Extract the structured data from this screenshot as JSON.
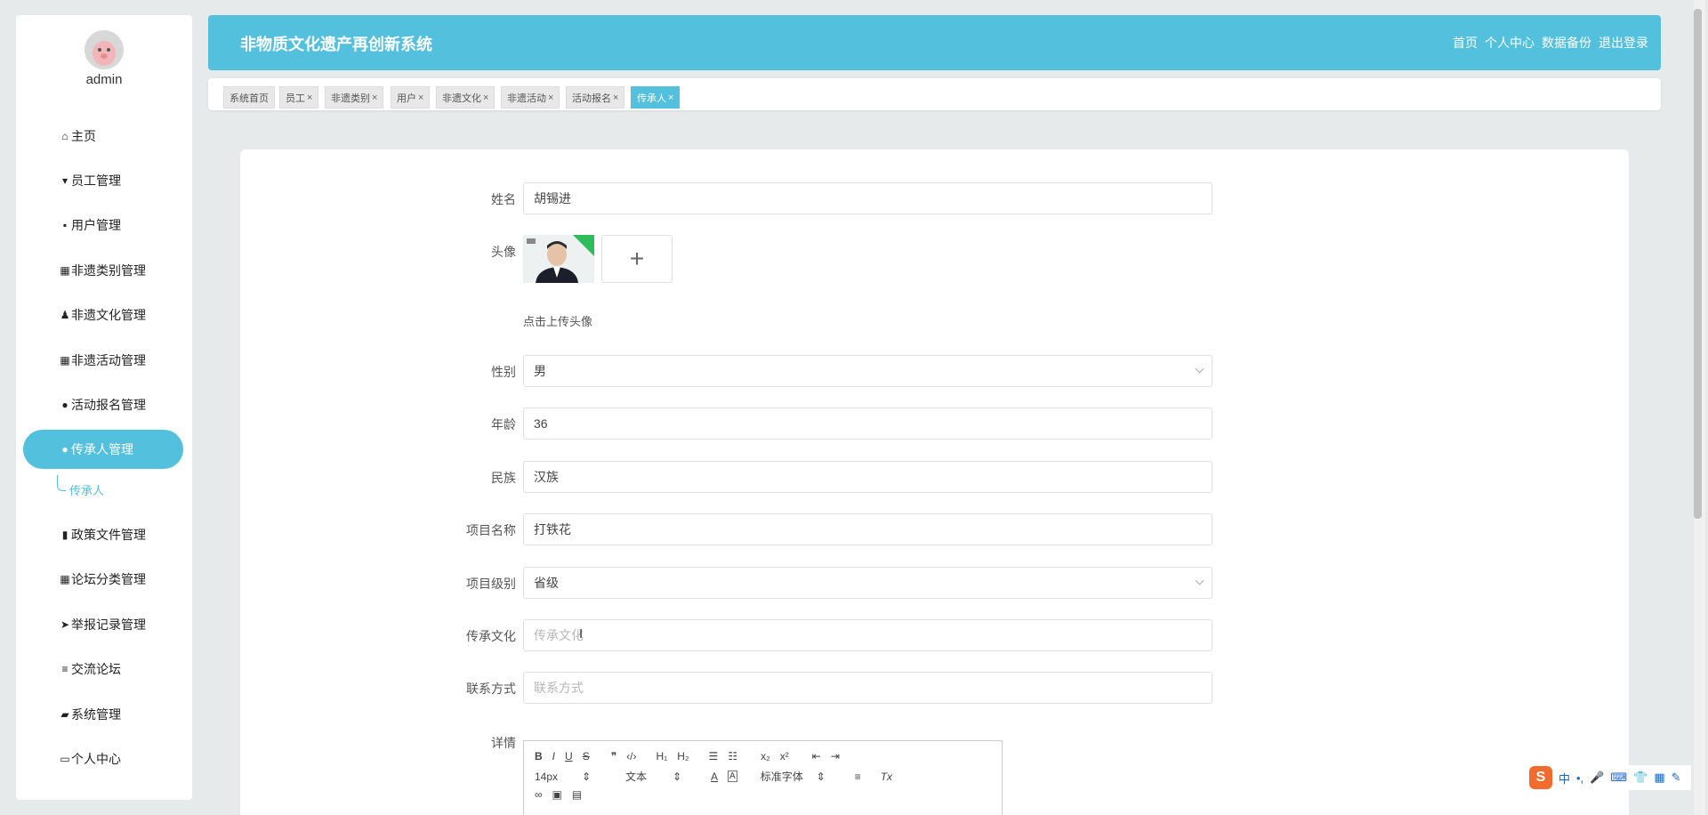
{
  "sidebar": {
    "admin_name": "admin",
    "items": [
      {
        "label": "主页",
        "icon": "home-icon"
      },
      {
        "label": "员工管理",
        "icon": "employee-icon"
      },
      {
        "label": "用户管理",
        "icon": "chat-icon"
      },
      {
        "label": "非遗类别管理",
        "icon": "grid-icon"
      },
      {
        "label": "非遗文化管理",
        "icon": "user-icon"
      },
      {
        "label": "非遗活动管理",
        "icon": "grid-icon"
      },
      {
        "label": "活动报名管理",
        "icon": "person-icon"
      },
      {
        "label": "传承人管理",
        "icon": "bulb-icon"
      },
      {
        "label": "政策文件管理",
        "icon": "bar-chart-icon"
      },
      {
        "label": "论坛分类管理",
        "icon": "grid-icon"
      },
      {
        "label": "举报记录管理",
        "icon": "send-icon"
      },
      {
        "label": "交流论坛",
        "icon": "list-icon"
      },
      {
        "label": "系统管理",
        "icon": "briefcase-icon"
      },
      {
        "label": "个人中心",
        "icon": "calendar-icon"
      }
    ],
    "sub_item": "传承人"
  },
  "header": {
    "title": "非物质文化遗产再创新系统",
    "nav": [
      "首页",
      "个人中心",
      "数据备份",
      "退出登录"
    ]
  },
  "tabs": [
    {
      "label": "系统首页",
      "closable": false
    },
    {
      "label": "员工",
      "closable": true
    },
    {
      "label": "非遗类别",
      "closable": true
    },
    {
      "label": "用户",
      "closable": true
    },
    {
      "label": "非遗文化",
      "closable": true
    },
    {
      "label": "非遗活动",
      "closable": true
    },
    {
      "label": "活动报名",
      "closable": true
    },
    {
      "label": "传承人",
      "closable": true
    }
  ],
  "tab_close_glyph": "×",
  "form": {
    "name_label": "姓名",
    "name_value": "胡锡进",
    "avatar_label": "头像",
    "upload_plus": "+",
    "upload_hint": "点击上传头像",
    "gender_label": "性别",
    "gender_value": "男",
    "age_label": "年龄",
    "age_value": "36",
    "ethnicity_label": "民族",
    "ethnicity_value": "汉族",
    "project_label": "项目名称",
    "project_value": "打铁花",
    "level_label": "项目级别",
    "level_value": "省级",
    "heritage_label": "传承文化",
    "heritage_placeholder": "传承文化",
    "contact_label": "联系方式",
    "contact_placeholder": "联系方式",
    "detail_label": "详情"
  },
  "editor": {
    "row1": [
      "B",
      "I",
      "U",
      "S",
      "❞",
      "‹/›",
      "H₁",
      "H₂",
      "☰",
      "☷",
      "x₂",
      "x²",
      "⇤",
      "⇥"
    ],
    "font_size": "14px",
    "block_type": "文本",
    "font_family": "标准字体",
    "clear_format": "Tx"
  },
  "ime": {
    "logo": "S",
    "items": [
      "中",
      "•,",
      "🎤",
      "⌨",
      "👕",
      "▦",
      "✎"
    ]
  }
}
